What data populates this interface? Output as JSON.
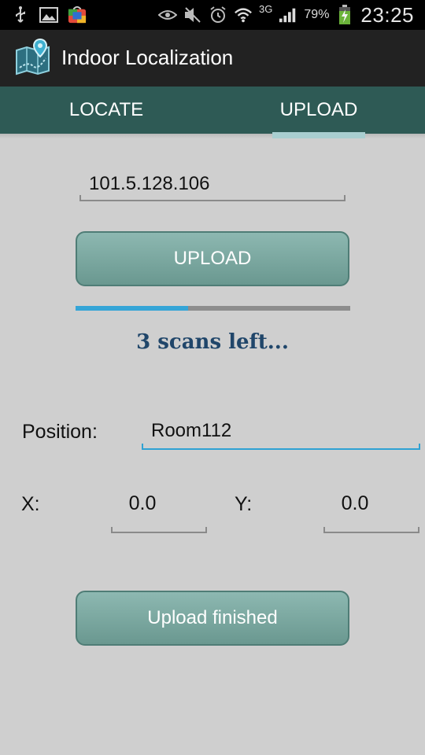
{
  "status_bar": {
    "battery": "79%",
    "network": "3G",
    "time": "23:25",
    "icons_left": [
      "usb-icon",
      "image-icon",
      "store-icon"
    ],
    "icons_right": [
      "eye-icon",
      "mute-icon",
      "alarm-icon",
      "wifi-icon",
      "signal-icon",
      "battery-charging-icon"
    ]
  },
  "app": {
    "title": "Indoor Localization",
    "logo_icon": "map-pin-icon"
  },
  "tabs": [
    {
      "label": "LOCATE",
      "selected": false
    },
    {
      "label": "UPLOAD",
      "selected": true
    }
  ],
  "upload": {
    "server_address": "101.5.128.106",
    "upload_button": "UPLOAD",
    "progress_fraction": 0.41,
    "status_message": "3 scans left..."
  },
  "position": {
    "label": "Position:",
    "value": "Room112"
  },
  "coords": {
    "x_label": "X:",
    "x_value": "0.0",
    "y_label": "Y:",
    "y_value": "0.0"
  },
  "finish_button": "Upload finished",
  "colors": {
    "tab_bar": "#2e5a55",
    "tab_indicator": "#a9ced0",
    "progress": "#35a5d7",
    "status_text": "#20466a",
    "button": "#7aa69f"
  }
}
